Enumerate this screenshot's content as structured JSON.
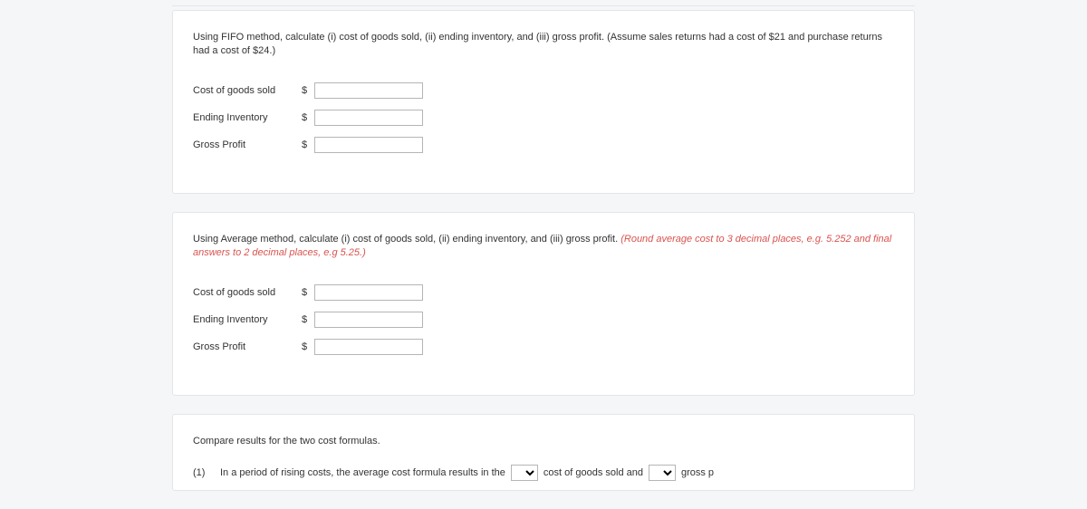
{
  "sections": [
    {
      "instruction_main": "Using FIFO method, calculate (i) cost of goods sold, (ii) ending inventory, and (iii) gross profit. (Assume sales returns had a cost of $21 and purchase returns had a cost of $24.)",
      "instruction_red": "",
      "rows": [
        {
          "label": "Cost of goods sold",
          "currency": "$",
          "value": ""
        },
        {
          "label": "Ending Inventory",
          "currency": "$",
          "value": ""
        },
        {
          "label": "Gross Profit",
          "currency": "$",
          "value": ""
        }
      ]
    },
    {
      "instruction_main": "Using Average method, calculate (i) cost of goods sold, (ii) ending inventory, and (iii) gross profit. ",
      "instruction_red": "(Round average cost to 3 decimal places, e.g. 5.252 and final answers to 2 decimal places, e.g 5.25.)",
      "rows": [
        {
          "label": "Cost of goods sold",
          "currency": "$",
          "value": ""
        },
        {
          "label": "Ending Inventory",
          "currency": "$",
          "value": ""
        },
        {
          "label": "Gross Profit",
          "currency": "$",
          "value": ""
        }
      ]
    }
  ],
  "compare": {
    "heading": "Compare results for the two cost formulas.",
    "item_number": "(1)",
    "text_a": "In a period of rising costs, the average cost formula results in the",
    "select1_visible": "",
    "text_b": "cost of goods sold and",
    "select2_visible": "",
    "text_c": "gross p"
  }
}
